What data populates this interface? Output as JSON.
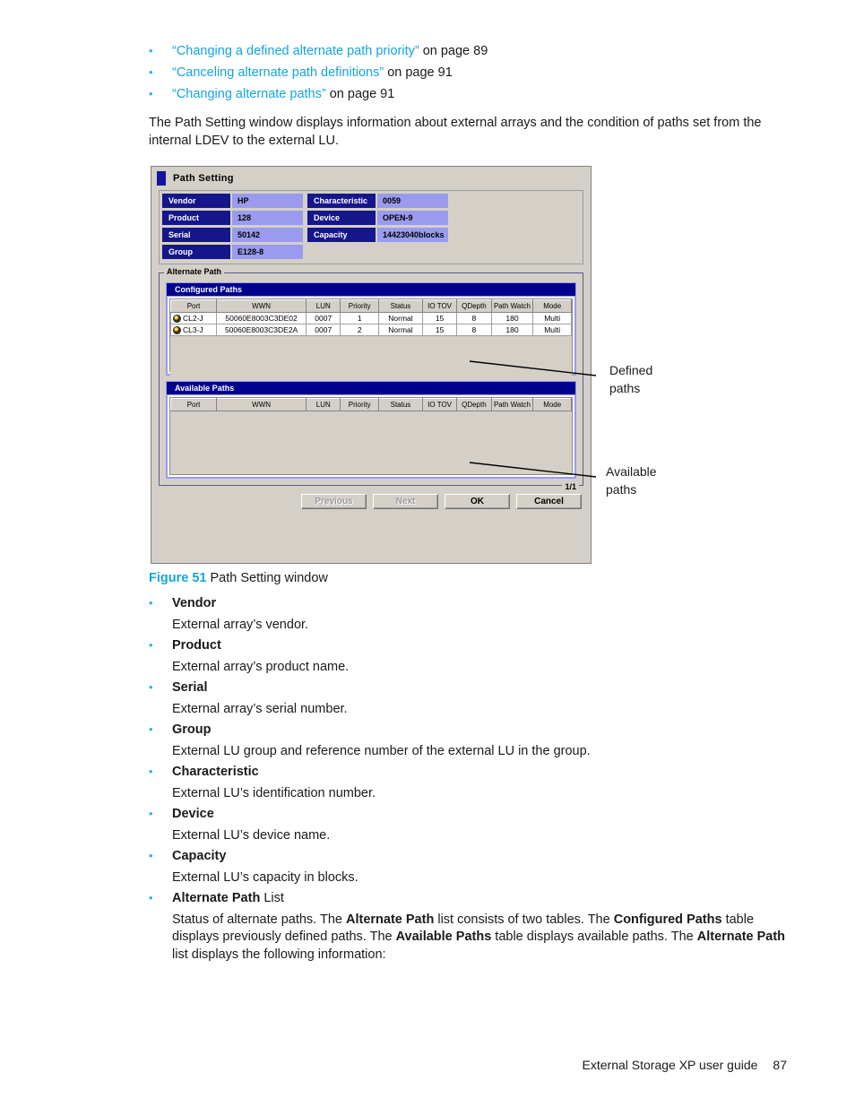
{
  "links": [
    {
      "bullet": "•",
      "quoted": "“Changing a defined alternate path priority”",
      "tail": " on page 89"
    },
    {
      "bullet": "•",
      "quoted": "“Canceling alternate path definitions”",
      "tail": " on page 91"
    },
    {
      "bullet": "•",
      "quoted": "“Changing alternate paths”",
      "tail": " on page 91"
    }
  ],
  "intro": "The Path Setting window displays information about external arrays and the condition of paths set from the internal LDEV to the external LU.",
  "dialog": {
    "title": "Path Setting",
    "info": {
      "vendor_label": "Vendor",
      "vendor_value": "HP",
      "product_label": "Product",
      "product_value": "128",
      "serial_label": "Serial",
      "serial_value": "50142",
      "group_label": "Group",
      "group_value": "E128-8",
      "characteristic_label": "Characteristic",
      "characteristic_value": "0059",
      "device_label": "Device",
      "device_value": "OPEN-9",
      "capacity_label": "Capacity",
      "capacity_value": "14423040blocks"
    },
    "alternate_path_legend": "Alternate Path",
    "page_indicator": "1/1",
    "columns": [
      "Port",
      "WWN",
      "LUN",
      "Priority",
      "Status",
      "IO TOV",
      "QDepth",
      "Path Watch",
      "Mode"
    ],
    "configured_paths": {
      "title": "Configured Paths",
      "rows": [
        {
          "icon": "user-path-icon",
          "port": "CL2-J",
          "wwn": "50060E8003C3DE02",
          "lun": "0007",
          "priority": "1",
          "status": "Normal",
          "io_tov": "15",
          "qdepth": "8",
          "path_watch": "180",
          "mode": "Multi"
        },
        {
          "icon": "user-path-icon",
          "port": "CL3-J",
          "wwn": "50060E8003C3DE2A",
          "lun": "0007",
          "priority": "2",
          "status": "Normal",
          "io_tov": "15",
          "qdepth": "8",
          "path_watch": "180",
          "mode": "Multi"
        }
      ]
    },
    "available_paths": {
      "title": "Available Paths",
      "rows": []
    },
    "buttons": [
      {
        "label": "Previous",
        "disabled": true
      },
      {
        "label": "Next",
        "disabled": true
      },
      {
        "label": "OK",
        "disabled": false
      },
      {
        "label": "Cancel",
        "disabled": false
      }
    ]
  },
  "callouts": {
    "defined_line1": "Defined",
    "defined_line2": "paths",
    "available_line1": "Available",
    "available_line2": "paths"
  },
  "figure": {
    "number": "Figure 51",
    "caption": "Path Setting window"
  },
  "definitions": [
    {
      "term": "Vendor",
      "desc": "External array’s vendor."
    },
    {
      "term": "Product",
      "desc": "External array’s product name."
    },
    {
      "term": "Serial",
      "desc": "External array’s serial number."
    },
    {
      "term": "Group",
      "desc": "External LU group and reference number of the external LU in the group."
    },
    {
      "term": "Characteristic",
      "desc": "External LU’s identification number."
    },
    {
      "term": "Device",
      "desc": "External LU’s device name."
    },
    {
      "term": "Capacity",
      "desc": "External LU’s capacity in blocks."
    }
  ],
  "alt_path_entry": {
    "term_bold": "Alternate Path",
    "term_rest": " List",
    "desc_p1": "Status of alternate paths. The ",
    "desc_b1": "Alternate Path",
    "desc_p2": " list consists of two tables. The ",
    "desc_b2": "Configured Paths",
    "desc_p3": " table displays previously defined paths. The ",
    "desc_b3": "Available Paths",
    "desc_p4": " table displays available paths. The ",
    "desc_b4": "Alternate Path",
    "desc_p5": " list displays the following information:"
  },
  "footer": {
    "guide": "External Storage XP user guide",
    "page": "87"
  },
  "colors": {
    "link": "#15a4dd",
    "bullet": "#2fb0e4",
    "label_bg": "#16168c",
    "value_bg": "#9a9aef",
    "header_bg": "#00008f",
    "dialog_bg": "#d4d0c8"
  }
}
